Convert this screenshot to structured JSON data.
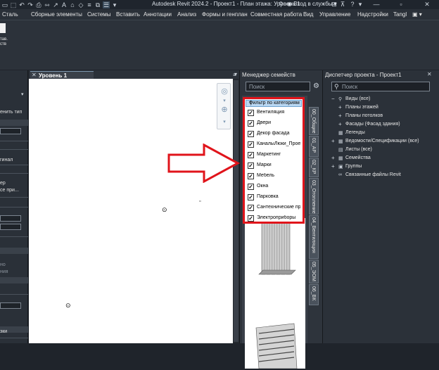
{
  "titlebar": {
    "title": "Autodesk Revit 2024.2 - Проект1 - План этажа: Уровень 1",
    "user": "Вход в службы"
  },
  "menu": [
    "Сталь",
    "Сборные элементы",
    "Системы",
    "Вставить",
    "Аннотации",
    "Анализ",
    "Формы и генплан",
    "Совместная работа",
    "Вид",
    "Управление",
    "Надстройки",
    "Tangl"
  ],
  "ribbon": {
    "btn_line1": "тав.",
    "btn_line2": "ств"
  },
  "properties": {
    "items": [
      "енить тип",
      "гинал",
      "ер",
      "се при...",
      "но",
      "ния",
      "зки"
    ]
  },
  "view": {
    "tab_label": "Уровень 1",
    "tab_close": "✕"
  },
  "family_manager": {
    "title": "Менеджер семейств",
    "search_placeholder": "Поиск",
    "filter_header": "Фильтр по категориям",
    "filter_items": [
      "Вентиляция",
      "Двери",
      "Декор фасада",
      "КаналыЛюки_Проект",
      "Маркетинг",
      "Марки",
      "Мебель",
      "Окна",
      "Парковка",
      "Сантехнические приборы",
      "Электроприборы"
    ],
    "vertical_tabs": [
      "00_Общие",
      "01_АР",
      "02_КР",
      "03_Отопление",
      "04_Вентиляция",
      "05_ЭОМ",
      "06_ВК"
    ]
  },
  "project_browser": {
    "title": "Диспетчер проекта - Проект1",
    "search_placeholder": "Поиск",
    "tree": [
      {
        "label": "Виды (все)",
        "expander": "−",
        "icon": "⚲",
        "level": 0
      },
      {
        "label": "Планы этажей",
        "expander": "+",
        "icon": "",
        "level": 1
      },
      {
        "label": "Планы потолков",
        "expander": "+",
        "icon": "",
        "level": 1
      },
      {
        "label": "Фасады (Фасад здания)",
        "expander": "+",
        "icon": "",
        "level": 1
      },
      {
        "label": "Легенды",
        "expander": "",
        "icon": "▦",
        "level": 0
      },
      {
        "label": "Ведомости/Спецификации (все)",
        "expander": "+",
        "icon": "▦",
        "level": 0
      },
      {
        "label": "Листы (все)",
        "expander": "",
        "icon": "▤",
        "level": 0
      },
      {
        "label": "Семейства",
        "expander": "+",
        "icon": "▦",
        "level": 0
      },
      {
        "label": "Группы",
        "expander": "+",
        "icon": "▣",
        "level": 0
      },
      {
        "label": "Связанные файлы Revit",
        "expander": "",
        "icon": "∞",
        "level": 0
      }
    ]
  },
  "colors": {
    "highlight": "#e0141b",
    "dark_bg": "#2b3139"
  }
}
